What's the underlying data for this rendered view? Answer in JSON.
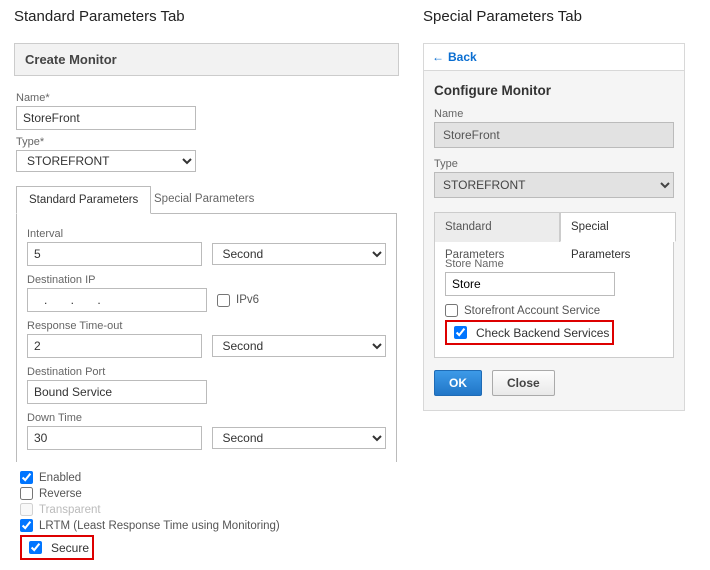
{
  "left": {
    "section_title": "Standard Parameters Tab",
    "panel_title": "Create Monitor",
    "name_label": "Name*",
    "name_value": "StoreFront",
    "type_label": "Type*",
    "type_value": "STOREFRONT",
    "tabs": {
      "standard": "Standard Parameters",
      "special": "Special Parameters"
    },
    "fields": {
      "interval_label": "Interval",
      "interval_value": "5",
      "interval_unit": "Second",
      "destip_label": "Destination IP",
      "destip_value": "   .       .       .",
      "ipv6_label": "IPv6",
      "timeout_label": "Response Time-out",
      "timeout_value": "2",
      "timeout_unit": "Second",
      "destport_label": "Destination Port",
      "destport_value": "Bound Service",
      "downtime_label": "Down Time",
      "downtime_value": "30",
      "downtime_unit": "Second"
    },
    "checks": {
      "enabled": "Enabled",
      "reverse": "Reverse",
      "transparent": "Transparent",
      "lrtm": "LRTM (Least Response Time using Monitoring)",
      "secure": "Secure"
    }
  },
  "right": {
    "section_title": "Special Parameters Tab",
    "back_label": "Back",
    "panel_title": "Configure Monitor",
    "name_label": "Name",
    "name_value": "StoreFront",
    "type_label": "Type",
    "type_value": "STOREFRONT",
    "tabs": {
      "standard": "Standard Parameters",
      "special": "Special Parameters"
    },
    "store_name_label": "Store Name",
    "store_name_value": "Store",
    "sf_account_service": "Storefront Account Service",
    "check_backend": "Check Backend Services",
    "ok": "OK",
    "close": "Close"
  }
}
